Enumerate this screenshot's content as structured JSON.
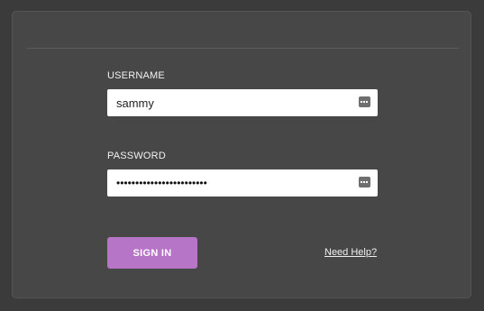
{
  "login": {
    "username_label": "USERNAME",
    "username_value": "sammy",
    "password_label": "PASSWORD",
    "password_value": "••••••••••••••••••••••••",
    "sign_in_label": "SIGN IN",
    "help_link": "Need Help?"
  },
  "icons": {
    "username_field_icon": "keyboard-dots-icon",
    "password_field_icon": "keyboard-dots-icon"
  },
  "colors": {
    "page_background": "#3b3b3b",
    "card_background": "#474747",
    "button_background": "#b775c8",
    "button_text": "#ffffff",
    "label_text": "#f2f2f2"
  }
}
